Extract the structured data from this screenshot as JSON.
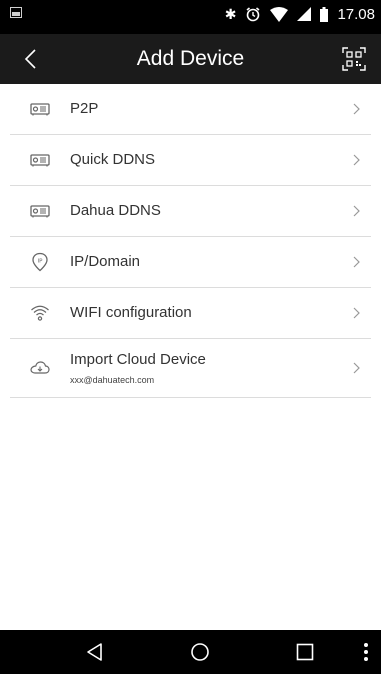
{
  "status_bar": {
    "time": "17.08"
  },
  "header": {
    "title": "Add Device"
  },
  "items": [
    {
      "label": "P2P",
      "icon": "device-icon"
    },
    {
      "label": "Quick DDNS",
      "icon": "device-icon"
    },
    {
      "label": "Dahua DDNS",
      "icon": "device-icon"
    },
    {
      "label": "IP/Domain",
      "icon": "ip-pin-icon"
    },
    {
      "label": "WIFI configuration",
      "icon": "wifi-icon"
    },
    {
      "label": "Import Cloud Device",
      "sublabel": "xxx@dahuatech.com",
      "icon": "cloud-download-icon"
    }
  ],
  "colors": {
    "header_bg": "#1b1b1b",
    "status_bg": "#000000",
    "divider": "#dcdcdc",
    "text": "#333333"
  }
}
